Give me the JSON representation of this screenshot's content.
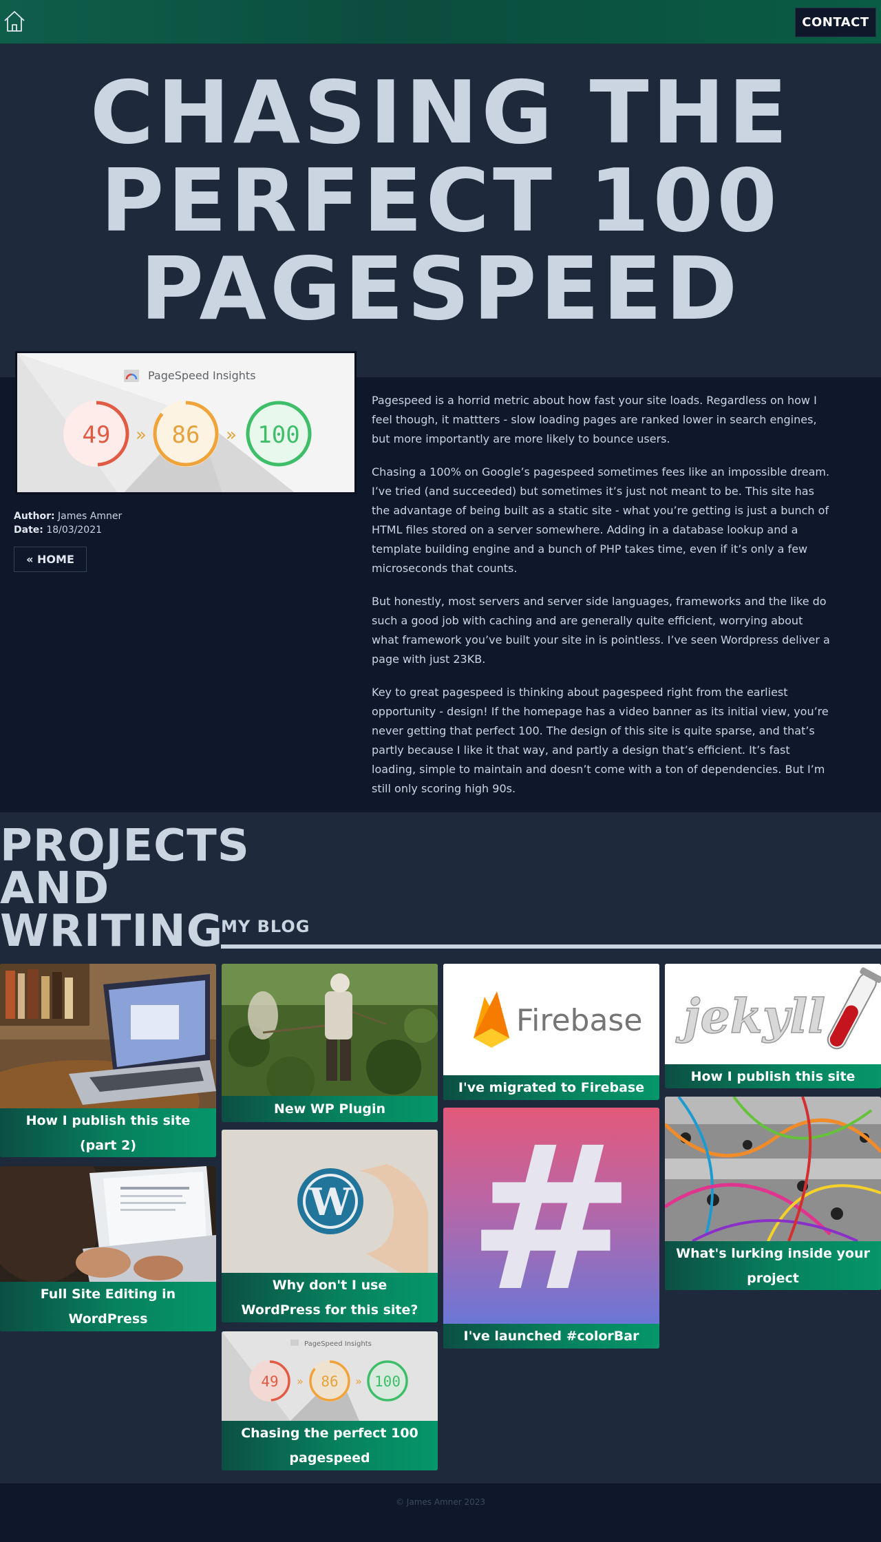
{
  "header": {
    "contact_label": "CONTACT"
  },
  "hero": {
    "title": "CHASING THE PERFECT 100 PAGESPEED"
  },
  "article": {
    "psi_brand": "PageSpeed Insights",
    "scores": [
      "49",
      "86",
      "100"
    ],
    "author_label": "Author:",
    "author": "James Amner",
    "date_label": "Date:",
    "date": "18/03/2021",
    "home_label": "« HOME",
    "paragraphs": [
      "Pagespeed is a horrid metric about how fast your site loads. Regardless on how I feel though, it mattters - slow loading pages are ranked lower in search engines, but more importantly are more likely to bounce users.",
      "Chasing a 100% on Google’s pagespeed sometimes fees like an impossible dream. I’ve tried (and succeeded) but sometimes it’s just not meant to be. This site has the advantage of being built as a static site - what you’re getting is just a bunch of HTML files stored on a server somewhere. Adding in a database lookup and a template building engine and a bunch of PHP takes time, even if it’s only a few microseconds that counts.",
      "But honestly, most servers and server side languages, frameworks and the like do such a good job with caching and are generally quite efficient, worrying about what framework you’ve built your site in is pointless. I’ve seen Wordpress deliver a page with just 23KB.",
      "Key to great pagespeed is thinking about pagespeed right from the earliest opportunity - design! If the homepage has a video banner as its initial view, you’re never getting that perfect 100. The design of this site is quite sparse, and that’s partly because I like it that way, and partly a design that’s efficient. It’s fast loading, simple to maintain and doesn’t come with a ton of dependencies. But I’m still only scoring high 90s."
    ]
  },
  "projects": {
    "title_lines": [
      "PROJECTS",
      "AND",
      "WRITING"
    ],
    "blog_heading": "MY BLOG",
    "cards": [
      {
        "title": "How I publish this site (part 2)"
      },
      {
        "title": "Full Site Editing in WordPress"
      },
      {
        "title": "New WP Plugin"
      },
      {
        "title": "Why don't I use WordPress for this site?"
      },
      {
        "title": "Chasing the perfect 100 pagespeed"
      },
      {
        "title": "I've migrated to Firebase",
        "logo_text": "Firebase"
      },
      {
        "title": "I've launched #colorBar",
        "glyph": "#"
      },
      {
        "title": "How I publish this site",
        "logo_text": "jekyll"
      },
      {
        "title": "What's lurking inside your project"
      }
    ]
  },
  "footer": {
    "text": "© James Amner 2023"
  },
  "colors": {
    "accent": "#059669",
    "bg": "#1e293b",
    "dark": "#0f172a",
    "text": "#cbd5e1"
  }
}
